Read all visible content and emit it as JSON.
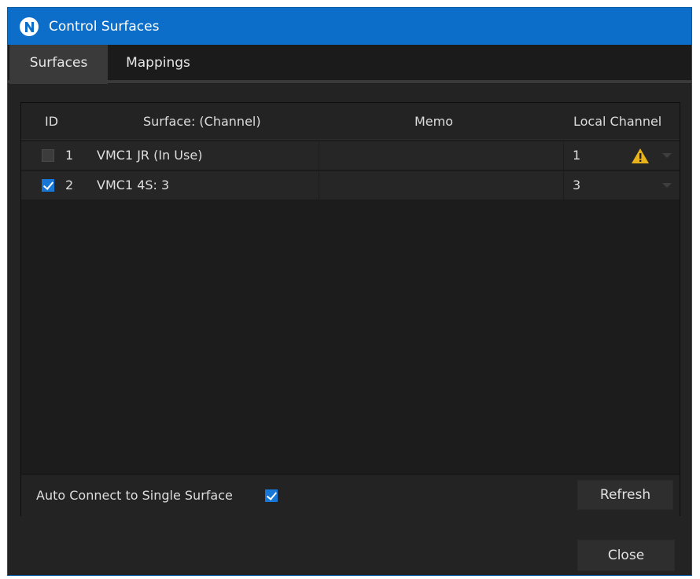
{
  "window": {
    "title": "Control Surfaces"
  },
  "tabs": [
    {
      "label": "Surfaces",
      "active": true
    },
    {
      "label": "Mappings",
      "active": false
    }
  ],
  "table": {
    "columns": [
      "ID",
      "Surface: (Channel)",
      "Memo",
      "Local Channel"
    ],
    "rows": [
      {
        "checked": false,
        "id": "1",
        "surface": "VMC1 JR (In Use)",
        "memo": "",
        "local_channel": "1",
        "warning": true
      },
      {
        "checked": true,
        "id": "2",
        "surface": "VMC1 4S: 3",
        "memo": "",
        "local_channel": "3",
        "warning": false
      }
    ]
  },
  "footer": {
    "auto_connect_label": "Auto Connect to Single Surface",
    "auto_connect_checked": true,
    "refresh_label": "Refresh"
  },
  "close_label": "Close",
  "colors": {
    "accent": "#0d6ec9",
    "checkbox_checked": "#1677d7",
    "warning": "#e8b21a"
  },
  "icons": [
    "app-logo-icon",
    "warning-icon",
    "chevron-down-icon",
    "checkmark-icon"
  ]
}
